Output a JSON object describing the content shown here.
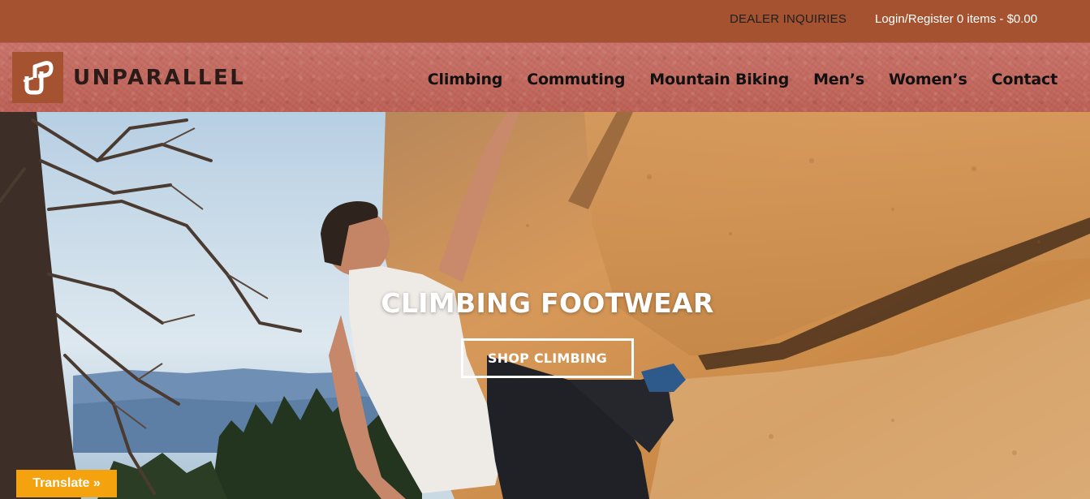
{
  "topbar": {
    "dealer_link": "DEALER INQUIRIES",
    "login_link": "Login/Register",
    "cart_summary": "0 items - $0.00"
  },
  "header": {
    "logo_text": "UNPARALLEL",
    "logo_icon": "up-logo-icon",
    "nav": [
      {
        "label": "Climbing"
      },
      {
        "label": "Commuting"
      },
      {
        "label": "Mountain Biking"
      },
      {
        "label": "Men’s"
      },
      {
        "label": "Women’s"
      },
      {
        "label": "Contact"
      }
    ]
  },
  "hero": {
    "title": "CLIMBING FOOTWEAR",
    "cta_label": "SHOP CLIMBING"
  },
  "translate_button": "Translate »",
  "colors": {
    "topbar_bg": "#a4522f",
    "header_granite": "#c46a5e",
    "translate_bg": "#f5a20f",
    "hero_text": "#ffffff"
  }
}
